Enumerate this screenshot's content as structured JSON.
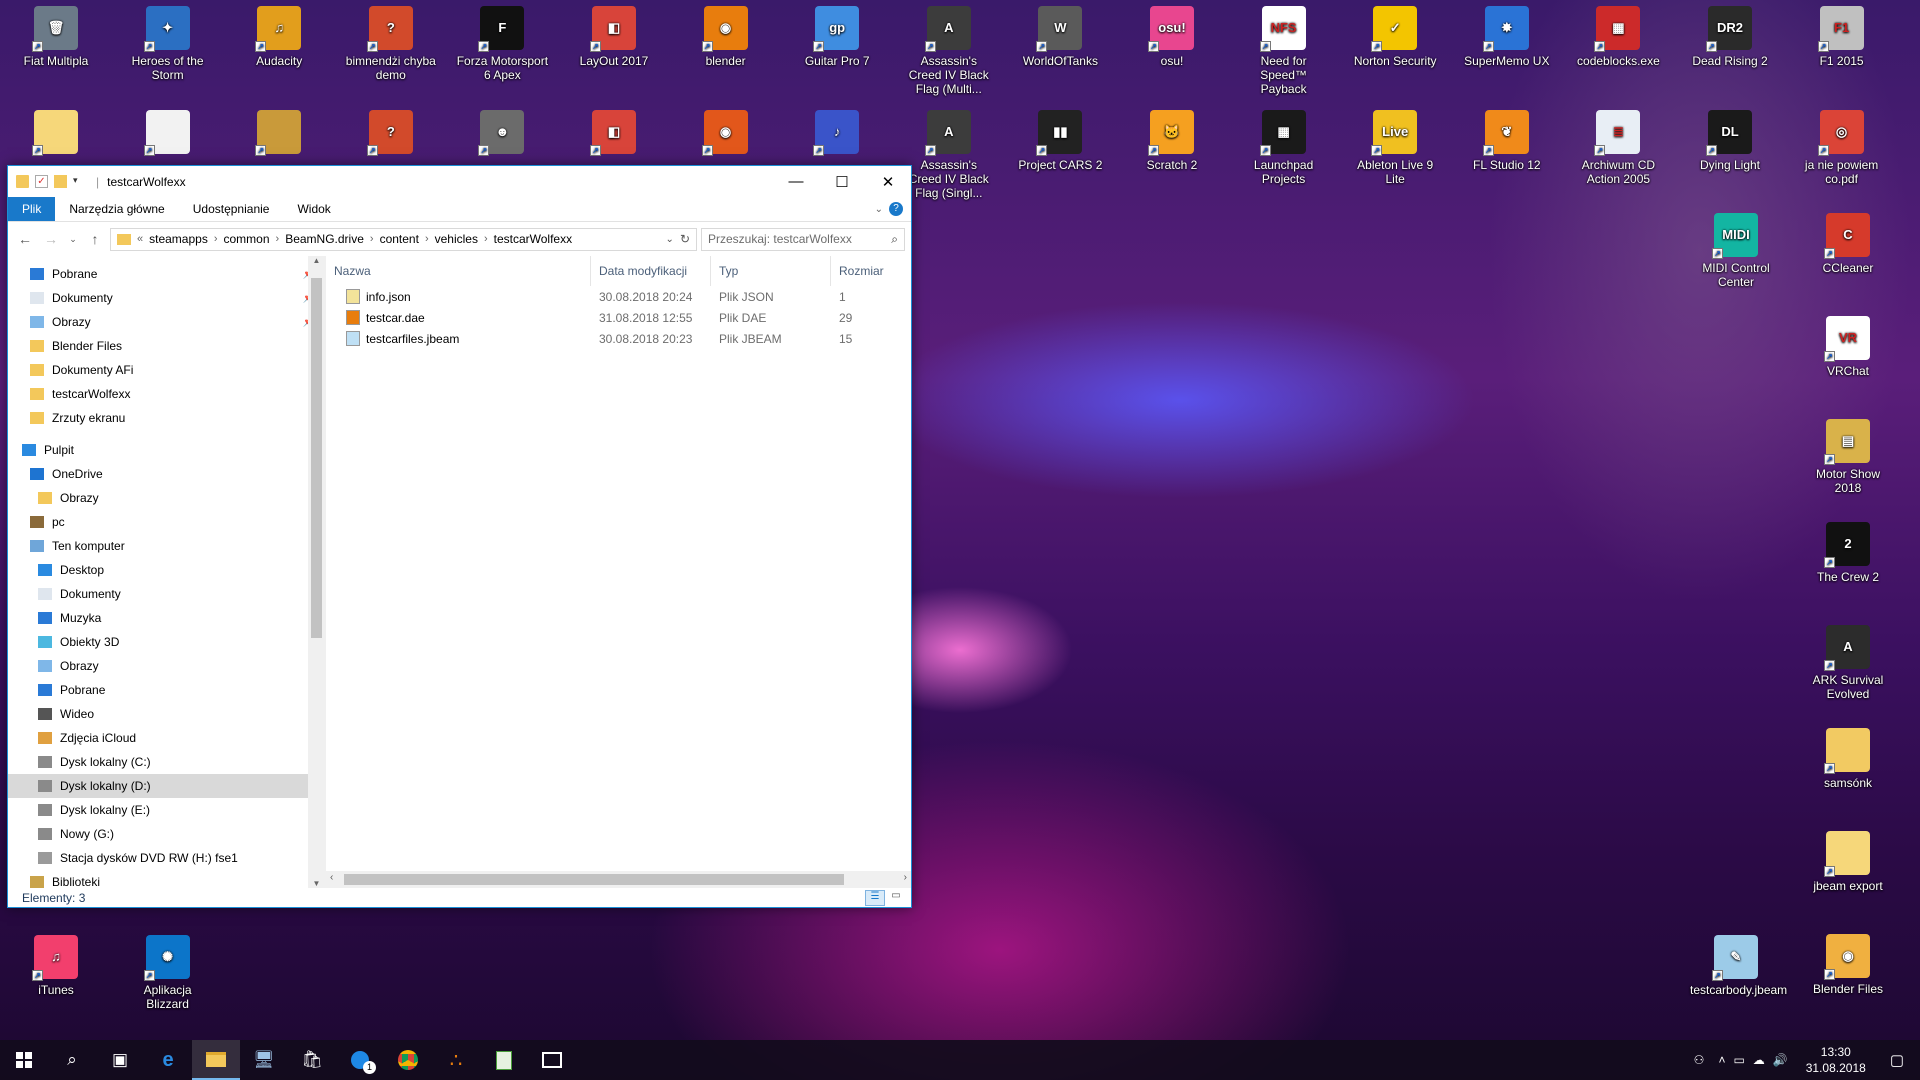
{
  "desktop": {
    "icons_row1": [
      {
        "label": "Fiat Multipla",
        "color": "#6b7a88",
        "glyph": "🗑"
      },
      {
        "label": "Heroes of the Storm",
        "color": "#2b6fc2",
        "glyph": "✦"
      },
      {
        "label": "Audacity",
        "color": "#e29e1c",
        "glyph": "♫"
      },
      {
        "label": "bimnendżi chyba demo",
        "color": "#d24a2b",
        "glyph": "?"
      },
      {
        "label": "Forza Motorsport 6 Apex",
        "color": "#111111",
        "glyph": "F"
      },
      {
        "label": "LayOut 2017",
        "color": "#d8443a",
        "glyph": "◧"
      },
      {
        "label": "blender",
        "color": "#e87d0d",
        "glyph": "◉"
      },
      {
        "label": "Guitar Pro 7",
        "color": "#3f8de0",
        "glyph": "gp"
      },
      {
        "label": "Assassin's Creed IV Black Flag (Multi...",
        "color": "#3c3c3c",
        "glyph": "A"
      },
      {
        "label": "WorldOfTanks",
        "color": "#5a5a5a",
        "glyph": "W"
      },
      {
        "label": "osu!",
        "color": "#e8468f",
        "glyph": "osu!"
      },
      {
        "label": "Need for Speed™ Payback",
        "color": "#ffffff",
        "glyph": "NFS"
      },
      {
        "label": "Norton Security",
        "color": "#f3c500",
        "glyph": "✓"
      },
      {
        "label": "SuperMemo UX",
        "color": "#2a73d6",
        "glyph": "✸"
      },
      {
        "label": "codeblocks.exe",
        "color": "#cc2a2a",
        "glyph": "▦"
      },
      {
        "label": "Dead Rising 2",
        "color": "#2a2a2a",
        "glyph": "DR2"
      },
      {
        "label": "F1 2015",
        "color": "#c0c0c0",
        "glyph": "F1"
      }
    ],
    "icons_row2": [
      {
        "label": "",
        "color": "#f6d77a",
        "glyph": ""
      },
      {
        "label": "",
        "color": "#f2f2f2",
        "glyph": ""
      },
      {
        "label": "",
        "color": "#c99a3a",
        "glyph": ""
      },
      {
        "label": "",
        "color": "#d24a2b",
        "glyph": "?"
      },
      {
        "label": "",
        "color": "#6b6b6b",
        "glyph": "☻"
      },
      {
        "label": "",
        "color": "#d8443a",
        "glyph": "◧"
      },
      {
        "label": "",
        "color": "#e2571b",
        "glyph": "◉"
      },
      {
        "label": "",
        "color": "#3a54c9",
        "glyph": "♪"
      },
      {
        "label": "Assassin's Creed IV Black Flag (Singl...",
        "color": "#3c3c3c",
        "glyph": "A"
      },
      {
        "label": "Project CARS 2",
        "color": "#222222",
        "glyph": "▮▮"
      },
      {
        "label": "Scratch 2",
        "color": "#f5a020",
        "glyph": "🐱"
      },
      {
        "label": "Launchpad Projects",
        "color": "#1a1a1a",
        "glyph": "▦"
      },
      {
        "label": "Ableton Live 9 Lite",
        "color": "#f0c020",
        "glyph": "Live"
      },
      {
        "label": "FL Studio 12",
        "color": "#f08a1a",
        "glyph": "❦"
      },
      {
        "label": "Archiwum CD Action 2005",
        "color": "#e8eef5",
        "glyph": "≣"
      },
      {
        "label": "Dying Light",
        "color": "#1a1a1a",
        "glyph": "DL"
      },
      {
        "label": "ja nie powiem co.pdf",
        "color": "#db4437",
        "glyph": "◎"
      }
    ],
    "icons_right": [
      {
        "label": "MIDI Control Center",
        "color": "#13b5a2",
        "glyph": "MIDI"
      },
      {
        "label": "CCleaner",
        "color": "#d63a2b",
        "glyph": "C"
      },
      {
        "label": "VRChat",
        "color": "#ffffff",
        "glyph": "VR"
      },
      {
        "label": "Motor Show 2018",
        "color": "#d9b24a",
        "glyph": "▤"
      },
      {
        "label": "The Crew 2",
        "color": "#111111",
        "glyph": "2"
      },
      {
        "label": "ARK Survival Evolved",
        "color": "#2c2c2c",
        "glyph": "A"
      },
      {
        "label": "samsónk",
        "color": "#f2ca62",
        "glyph": ""
      },
      {
        "label": "jbeam export",
        "color": "#f6d77a",
        "glyph": ""
      },
      {
        "label": "Blender Files",
        "color": "#f0b040",
        "glyph": "◉"
      }
    ],
    "icons_bottom_left": [
      {
        "label": "iTunes",
        "color": "#f23f6d",
        "glyph": "♫"
      },
      {
        "label": "Aplikacja Blizzard",
        "color": "#0c75c9",
        "glyph": "✺"
      }
    ],
    "icon_bottom_mid": {
      "label": "testcarbody.jbeam",
      "color": "#9ccbe8",
      "glyph": "✎"
    }
  },
  "explorer": {
    "title": "testcarWolfexx",
    "ribbon_tabs": [
      "Plik",
      "Narzędzia główne",
      "Udostępnianie",
      "Widok"
    ],
    "breadcrumb": [
      "steamapps",
      "common",
      "BeamNG.drive",
      "content",
      "vehicles",
      "testcarWolfexx"
    ],
    "breadcrumb_prefix": "«",
    "search_placeholder": "Przeszukaj: testcarWolfexx",
    "nav_items": [
      {
        "label": "Pobrane",
        "icon": "download-icon",
        "pinned": true,
        "indent": 1
      },
      {
        "label": "Dokumenty",
        "icon": "document-icon",
        "pinned": true,
        "indent": 1
      },
      {
        "label": "Obrazy",
        "icon": "pictures-icon",
        "pinned": true,
        "indent": 1
      },
      {
        "label": "Blender Files",
        "icon": "folder-icon",
        "pinned": false,
        "indent": 1
      },
      {
        "label": "Dokumenty AFi",
        "icon": "folder-icon",
        "pinned": false,
        "indent": 1
      },
      {
        "label": "testcarWolfexx",
        "icon": "folder-icon",
        "pinned": false,
        "indent": 1
      },
      {
        "label": "Zrzuty ekranu",
        "icon": "folder-icon",
        "pinned": false,
        "indent": 1
      },
      {
        "label": "",
        "icon": "",
        "pinned": false,
        "indent": 0,
        "spacer": true
      },
      {
        "label": "Pulpit",
        "icon": "desktop-icon",
        "pinned": false,
        "indent": 0
      },
      {
        "label": "OneDrive",
        "icon": "cloud-icon",
        "pinned": false,
        "indent": 1
      },
      {
        "label": "Obrazy",
        "icon": "folder-icon",
        "pinned": false,
        "indent": 2
      },
      {
        "label": "pc",
        "icon": "user-icon",
        "pinned": false,
        "indent": 1
      },
      {
        "label": "Ten komputer",
        "icon": "computer-icon",
        "pinned": false,
        "indent": 1
      },
      {
        "label": "Desktop",
        "icon": "desktop-icon",
        "pinned": false,
        "indent": 2
      },
      {
        "label": "Dokumenty",
        "icon": "document-icon",
        "pinned": false,
        "indent": 2
      },
      {
        "label": "Muzyka",
        "icon": "music-icon",
        "pinned": false,
        "indent": 2
      },
      {
        "label": "Obiekty 3D",
        "icon": "cube-icon",
        "pinned": false,
        "indent": 2
      },
      {
        "label": "Obrazy",
        "icon": "pictures-icon",
        "pinned": false,
        "indent": 2
      },
      {
        "label": "Pobrane",
        "icon": "download-icon",
        "pinned": false,
        "indent": 2
      },
      {
        "label": "Wideo",
        "icon": "video-icon",
        "pinned": false,
        "indent": 2
      },
      {
        "label": "Zdjęcia iCloud",
        "icon": "icloud-icon",
        "pinned": false,
        "indent": 2
      },
      {
        "label": "Dysk lokalny (C:)",
        "icon": "drive-icon",
        "pinned": false,
        "indent": 2
      },
      {
        "label": "Dysk lokalny (D:)",
        "icon": "drive-icon",
        "pinned": false,
        "indent": 2,
        "selected": true
      },
      {
        "label": "Dysk lokalny (E:)",
        "icon": "drive-icon",
        "pinned": false,
        "indent": 2
      },
      {
        "label": "Nowy (G:)",
        "icon": "drive-icon",
        "pinned": false,
        "indent": 2
      },
      {
        "label": "Stacja dysków DVD RW (H:) fse1",
        "icon": "dvd-icon",
        "pinned": false,
        "indent": 2
      },
      {
        "label": "Biblioteki",
        "icon": "library-icon",
        "pinned": false,
        "indent": 1
      }
    ],
    "columns": [
      "Nazwa",
      "Data modyfikacji",
      "Typ",
      "Rozmiar"
    ],
    "files": [
      {
        "name": "info.json",
        "date": "30.08.2018 20:24",
        "type": "Plik JSON",
        "size": "1",
        "icon": "json-file-icon"
      },
      {
        "name": "testcar.dae",
        "date": "31.08.2018 12:55",
        "type": "Plik DAE",
        "size": "29",
        "icon": "blender-file-icon"
      },
      {
        "name": "testcarfiles.jbeam",
        "date": "30.08.2018 20:23",
        "type": "Plik JBEAM",
        "size": "15",
        "icon": "jbeam-file-icon"
      }
    ],
    "status": "Elementy: 3"
  },
  "taskbar": {
    "time": "13:30",
    "date": "31.08.2018",
    "messenger_badge": "1"
  }
}
